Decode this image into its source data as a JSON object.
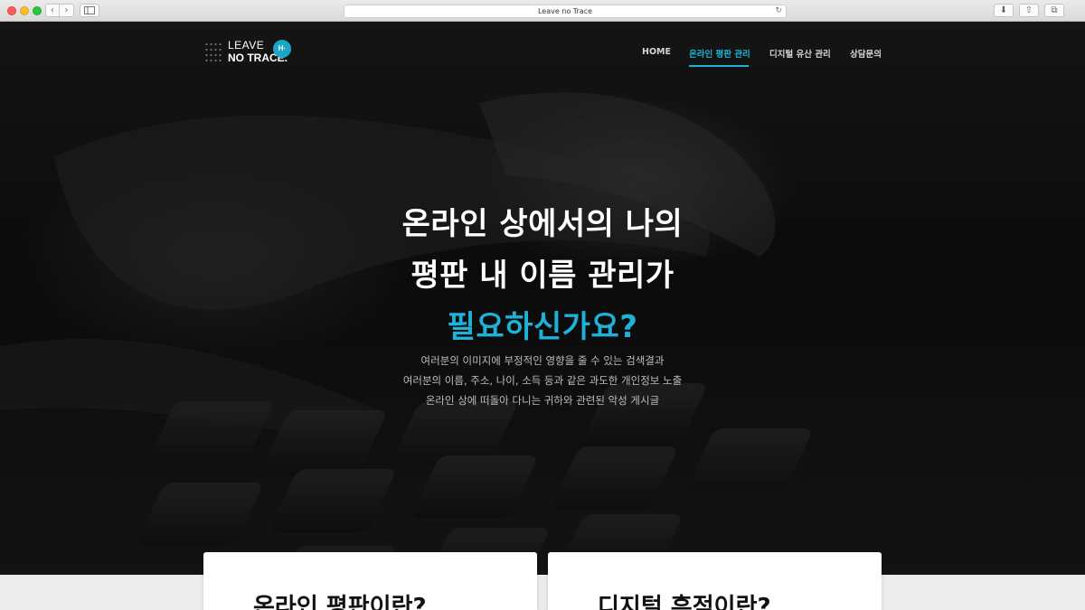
{
  "browser": {
    "title": "Leave no Trace",
    "back_icon": "‹",
    "forward_icon": "›",
    "reload_icon": "↻",
    "download_icon": "⬇",
    "share_icon": "⇧",
    "tabs_icon": "⧉",
    "newtab_icon": "+"
  },
  "logo": {
    "line1": "LEAVE",
    "line2": "NO TRACE.",
    "badge": "H·"
  },
  "nav": {
    "items": [
      {
        "label": "HOME"
      },
      {
        "label": "온라인 평판 관리"
      },
      {
        "label": "디지털 유산 관리"
      },
      {
        "label": "상담문의"
      }
    ],
    "active_index": 1
  },
  "hero": {
    "headline": [
      "온라인 상에서의 나의",
      "평판 내 이름 관리가",
      "필요하신가요?"
    ],
    "description": [
      "여러분의 이미지에 부정적인 영향을 줄 수 있는 검색결과",
      "여러분의 이름, 주소, 나이, 소득 등과 같은 과도한 개인정보 노출",
      "온라인 상에 떠돌아 다니는 귀하와 관련된 악성 게시글"
    ]
  },
  "cards": [
    {
      "title": "온라인 평판이란?"
    },
    {
      "title": "디지털 흔적이란?"
    }
  ],
  "colors": {
    "accent": "#1fb2d6",
    "hero_bg": "#141414",
    "card_bg": "#ffffff"
  }
}
